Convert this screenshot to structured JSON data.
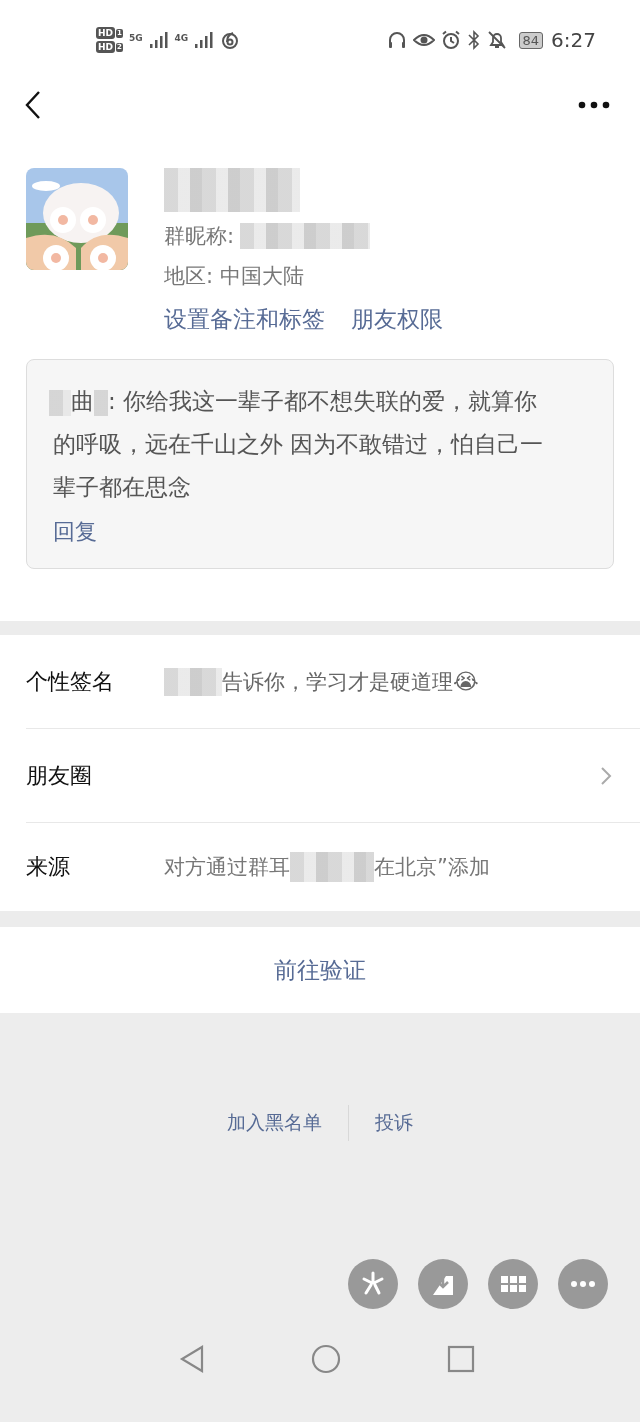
{
  "status_bar": {
    "sim_badges": [
      {
        "label": "HD",
        "slot": "1"
      },
      {
        "label": "HD",
        "slot": "2"
      }
    ],
    "networks": [
      "5G",
      "4G"
    ],
    "battery": "84",
    "time": "6:27"
  },
  "profile": {
    "nickname_label": "群昵称:",
    "region": "地区:  中国大陆",
    "actions": [
      "设置备注和标签",
      "朋友权限"
    ]
  },
  "comment": {
    "author": "曲",
    "text": ": 你给我这一辈子都不想失联的爱，就算你的呼吸，远在千山之外 因为不敢错过，怕自己一辈子都在思念",
    "reply": "回复"
  },
  "rows": [
    {
      "kind": "signature",
      "label": "个性签名",
      "value": "告诉你，学习才是硬道理",
      "emoji": "😭"
    },
    {
      "kind": "link",
      "label": "朋友圈"
    },
    {
      "kind": "source",
      "label": "来源",
      "value_start": "对方通过群耳",
      "value_end": "在北京”添加"
    }
  ],
  "verify_button": "前往验证",
  "footer_links": [
    "加入黑名单",
    "投诉"
  ]
}
